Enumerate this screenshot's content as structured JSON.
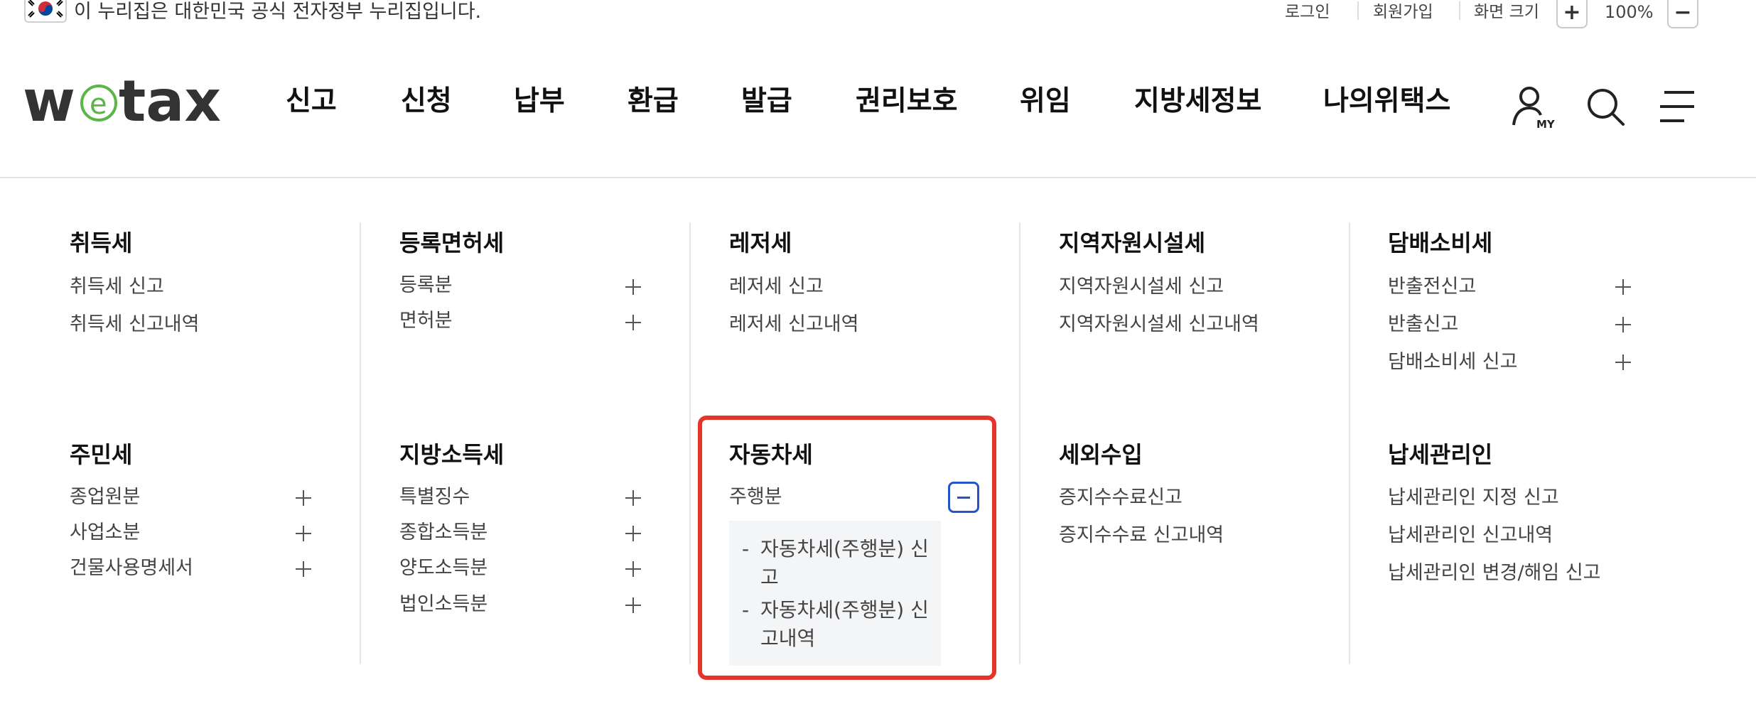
{
  "topbar": {
    "gov_notice": "이 누리집은 대한민국 공식 전자정부 누리집입니다.",
    "login": "로그인",
    "signup": "회원가입",
    "font_size_label": "화면 크기",
    "zoom_in": "+",
    "zoom_level": "100%",
    "zoom_out": "−"
  },
  "header": {
    "logo_text": "wetax",
    "nav": [
      "신고",
      "신청",
      "납부",
      "환급",
      "발급",
      "권리보호",
      "위임",
      "지방세정보",
      "나의위택스"
    ],
    "icons": [
      "my-page-icon",
      "search-icon",
      "menu-icon"
    ],
    "my_label": "MY"
  },
  "menu": {
    "row1": [
      {
        "title": "취득세",
        "items": [
          {
            "label": "취득세 신고",
            "plus": false
          },
          {
            "label": "취득세 신고내역",
            "plus": false
          }
        ]
      },
      {
        "title": "등록면허세",
        "items": [
          {
            "label": "등록분",
            "plus": true
          },
          {
            "label": "면허분",
            "plus": true
          }
        ]
      },
      {
        "title": "레저세",
        "items": [
          {
            "label": "레저세 신고",
            "plus": false
          },
          {
            "label": "레저세 신고내역",
            "plus": false
          }
        ]
      },
      {
        "title": "지역자원시설세",
        "items": [
          {
            "label": "지역자원시설세 신고",
            "plus": false
          },
          {
            "label": "지역자원시설세 신고내역",
            "plus": false
          }
        ]
      },
      {
        "title": "담배소비세",
        "items": [
          {
            "label": "반출전신고",
            "plus": true
          },
          {
            "label": "반출신고",
            "plus": true
          },
          {
            "label": "담배소비세 신고",
            "plus": true
          }
        ]
      }
    ],
    "row2": [
      {
        "title": "주민세",
        "items": [
          {
            "label": "종업원분",
            "plus": true
          },
          {
            "label": "사업소분",
            "plus": true
          },
          {
            "label": "건물사용명세서",
            "plus": true
          }
        ]
      },
      {
        "title": "지방소득세",
        "items": [
          {
            "label": "특별징수",
            "plus": true
          },
          {
            "label": "종합소득분",
            "plus": true
          },
          {
            "label": "양도소득분",
            "plus": true
          },
          {
            "label": "법인소득분",
            "plus": true
          }
        ]
      },
      {
        "title": "자동차세",
        "items": [
          {
            "label": "주행분",
            "plus": false
          }
        ]
      },
      {
        "title": "세외수입",
        "items": [
          {
            "label": "증지수수료신고",
            "plus": false
          },
          {
            "label": "증지수수료 신고내역",
            "plus": false
          }
        ]
      },
      {
        "title": "납세관리인",
        "items": [
          {
            "label": "납세관리인 지정 신고",
            "plus": false
          },
          {
            "label": "납세관리인 신고내역",
            "plus": false
          },
          {
            "label": "납세관리인 변경/해임 신고",
            "plus": false
          }
        ]
      }
    ],
    "expanded_submenu": {
      "parent": "주행분",
      "items": [
        "자동차세(주행분) 신고",
        "자동차세(주행분) 신고내역"
      ]
    }
  },
  "colors": {
    "highlight_border": "#e6342b",
    "minus_button": "#2553c8",
    "logo_green": "#5bb547",
    "logo_dark": "#333333"
  }
}
